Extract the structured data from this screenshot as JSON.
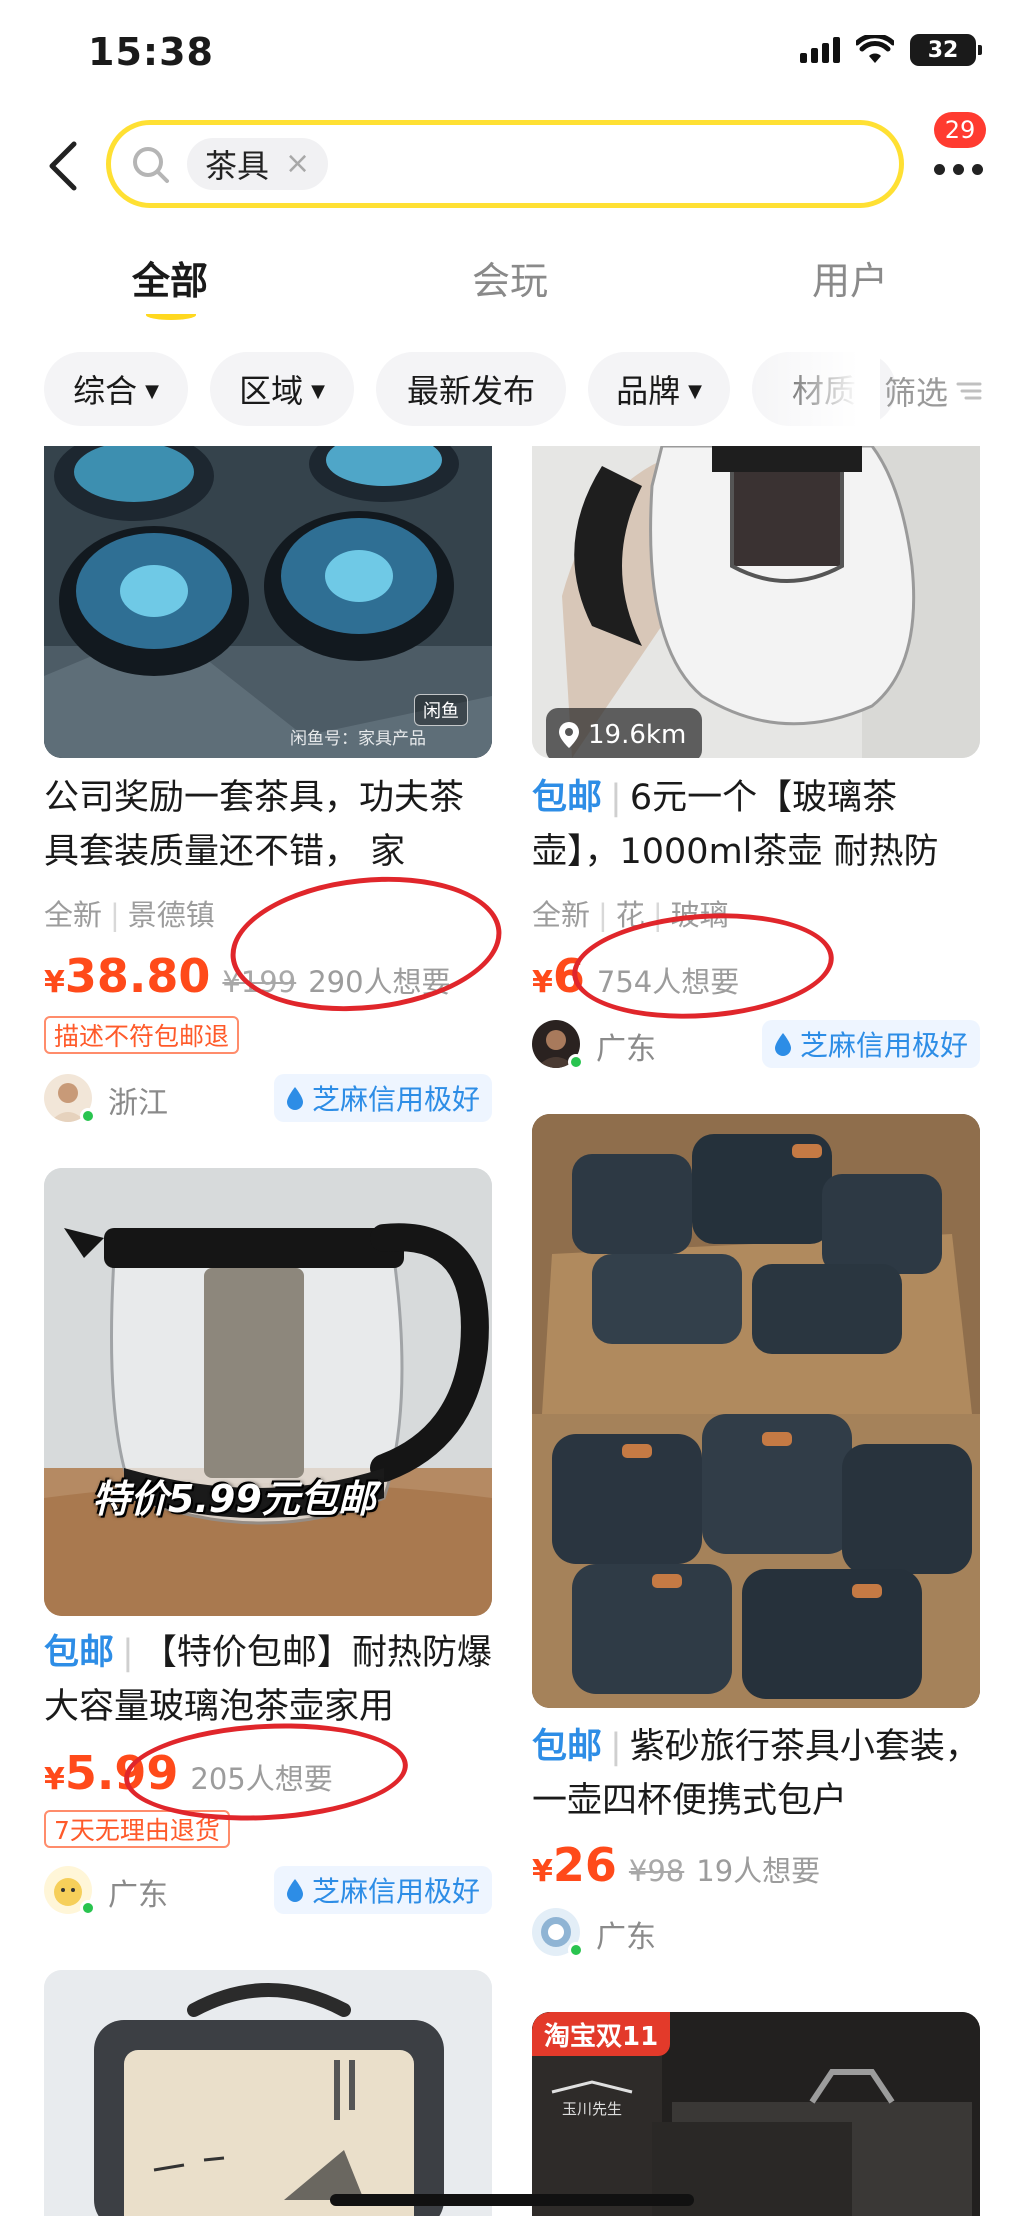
{
  "status_bar": {
    "time": "15:38",
    "battery": "32"
  },
  "search": {
    "query": "茶具",
    "notification_count": "29"
  },
  "tabs": [
    {
      "label": "全部",
      "active": true
    },
    {
      "label": "会玩",
      "active": false
    },
    {
      "label": "用户",
      "active": false
    }
  ],
  "filters": {
    "items": [
      "综合",
      "区域",
      "最新发布",
      "品牌",
      "材质"
    ],
    "screen_label": "筛选"
  },
  "products": [
    {
      "title": "公司奖励一套茶具，功夫茶具套装质量还不错， 家",
      "image_overlay": "闲鱼号：家具产品",
      "image_watermark": "闲鱼",
      "condition": "全新",
      "origin": "景德镇",
      "price": "38.80",
      "currency": "¥",
      "original_price": "¥199",
      "want_count": "290人想要",
      "tag": "描述不符包邮退",
      "seller_location": "浙江",
      "credit": "芝麻信用极好"
    },
    {
      "free_shipping": "包邮",
      "title": "6元一个【玻璃茶壶】，1000ml茶壶 耐热防",
      "distance": "19.6km",
      "condition": "全新",
      "brand": "花",
      "material": "玻璃",
      "price": "6",
      "currency": "¥",
      "want_count": "754人想要",
      "seller_location": "广东",
      "credit": "芝麻信用极好"
    },
    {
      "free_shipping": "包邮",
      "title": "【特价包邮】耐热防爆大容量玻璃泡茶壶家用",
      "image_overlay": "特价5.99元包邮",
      "price": "5.99",
      "currency": "¥",
      "want_count": "205人想要",
      "tag": "7天无理由退货",
      "seller_location": "广东",
      "credit": "芝麻信用极好"
    },
    {
      "free_shipping": "包邮",
      "title": "紫砂旅行茶具小套装，一壶四杯便携式包户",
      "price": "26",
      "currency": "¥",
      "original_price": "¥98",
      "want_count": "19人想要",
      "seller_location": "广东"
    },
    {
      "title": ""
    },
    {
      "image_tag": "淘宝双11",
      "image_brand": "玉川先生"
    }
  ],
  "colors": {
    "accent_yellow": "#ffe033",
    "price_red": "#ff4a1a",
    "link_blue": "#2d8de6",
    "annotation_red": "#e0262b"
  }
}
